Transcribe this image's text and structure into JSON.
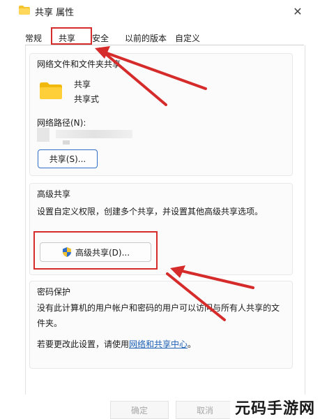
{
  "window": {
    "title": "共享 属性",
    "close_glyph": "✕"
  },
  "tabs": [
    "常规",
    "共享",
    "安全",
    "以前的版本",
    "自定义"
  ],
  "network_section": {
    "title": "网络文件和文件夹共享",
    "folder_name": "共享",
    "folder_state": "共享式",
    "path_label": "网络路径(N):",
    "share_button": "共享(S)..."
  },
  "advanced_section": {
    "title": "高级共享",
    "description": "设置自定义权限，创建多个共享，并设置其他高级共享选项。",
    "button": "高级共享(D)..."
  },
  "password_section": {
    "title": "密码保护",
    "line1": "没有此计算机的用户帐户和密码的用户可以访问与所有人共享的文",
    "line2": "件夹。",
    "change_prefix": "若要更改此设置，请使用",
    "link": "网络和共享中心",
    "change_suffix": "。"
  },
  "footer": {
    "ok": "确定",
    "cancel": "取消"
  },
  "watermark": "元码手游网",
  "colors": {
    "highlight_red": "#d62b2b",
    "folder_yellow": "#f4c430",
    "link_blue": "#1a5fb4",
    "primary_border": "#2f6fc9"
  },
  "icons": {
    "title_folder": "folder-icon",
    "shield": "shield-icon",
    "close": "close-icon"
  }
}
